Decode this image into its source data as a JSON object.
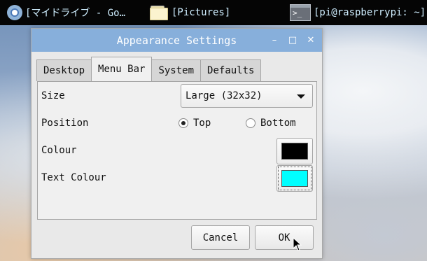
{
  "taskbar": {
    "items": [
      {
        "label": "[マイドライブ - Go…",
        "icon": "chromium-icon"
      },
      {
        "label": "[Pictures]",
        "icon": "folder-icon"
      },
      {
        "label": "[pi@raspberrypi: ~]",
        "icon": "terminal-icon"
      }
    ]
  },
  "window": {
    "title": "Appearance Settings",
    "controls": {
      "minimize": "–",
      "maximize": "□",
      "close": "✕"
    },
    "tabs": [
      {
        "label": "Desktop"
      },
      {
        "label": "Menu Bar",
        "active": true
      },
      {
        "label": "System"
      },
      {
        "label": "Defaults"
      }
    ],
    "size": {
      "label": "Size",
      "value": "Large (32x32)"
    },
    "position": {
      "label": "Position",
      "options": [
        "Top",
        "Bottom"
      ],
      "selected": "Top"
    },
    "colour": {
      "label": "Colour",
      "value": "#000000"
    },
    "text_colour": {
      "label": "Text Colour",
      "value": "#00ffff"
    },
    "buttons": {
      "cancel": "Cancel",
      "ok": "OK"
    }
  }
}
